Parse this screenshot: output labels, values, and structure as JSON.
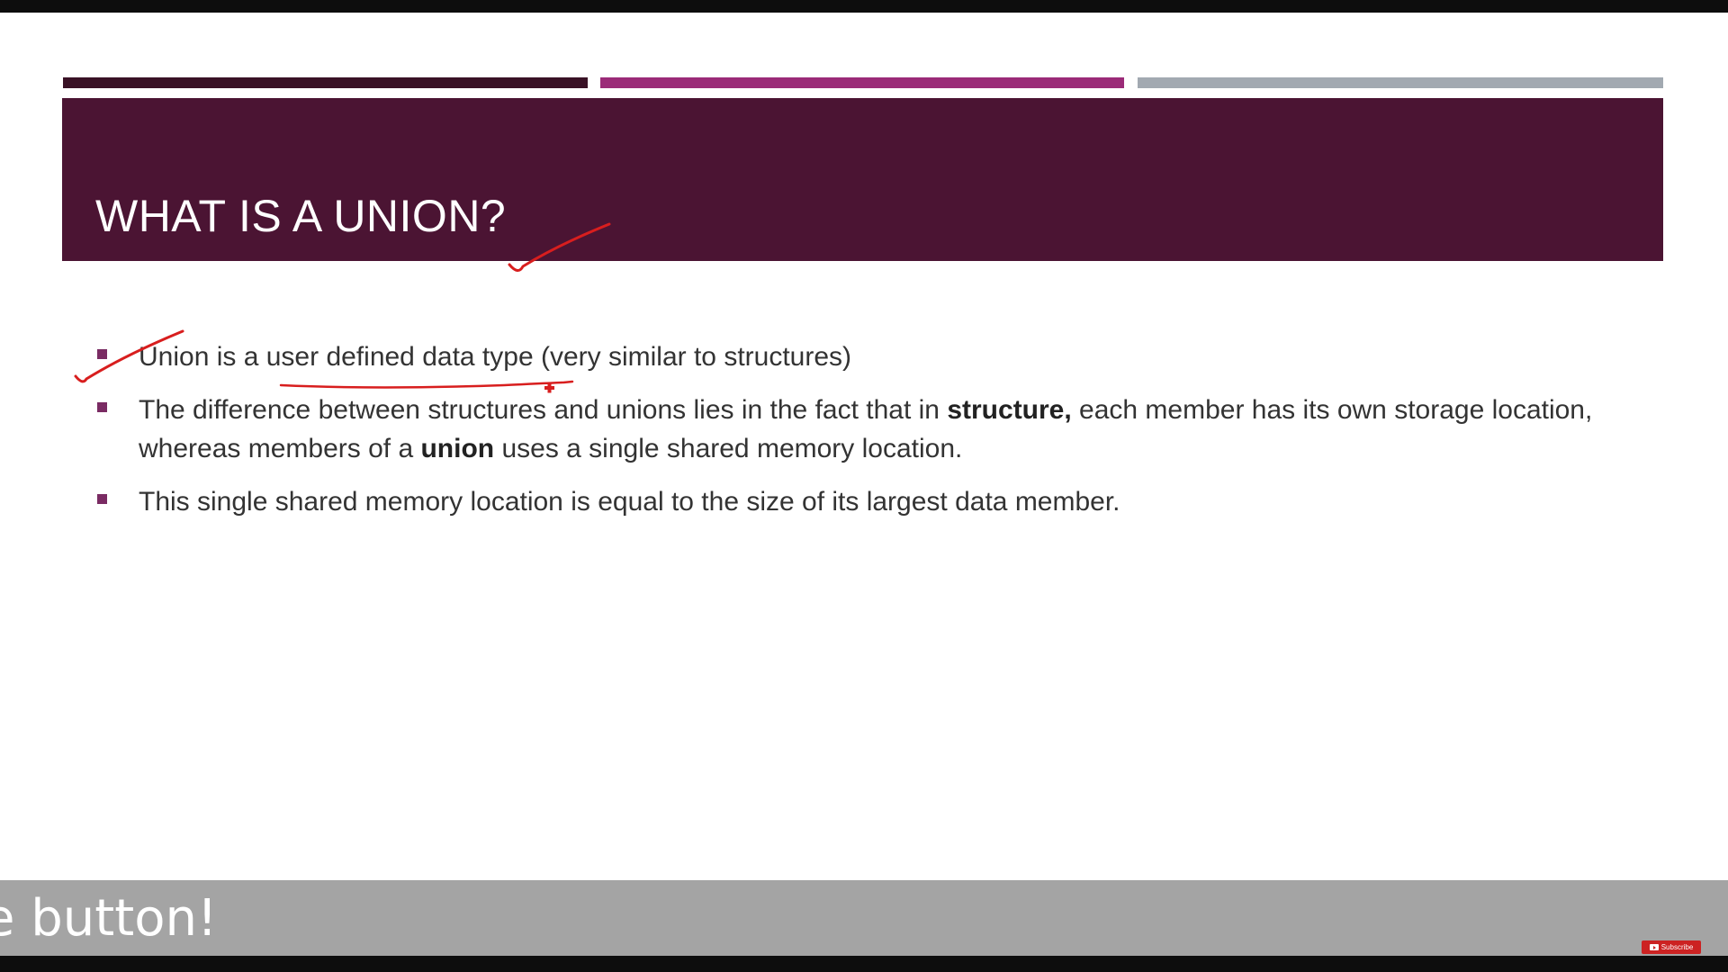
{
  "slide": {
    "title": "WHAT IS A UNION?",
    "bullets": [
      {
        "segments": [
          {
            "text": "Union is a ",
            "bold": false
          },
          {
            "text": "user defined data type",
            "bold": false
          },
          {
            "text": " (very similar to structures)",
            "bold": false
          }
        ]
      },
      {
        "segments": [
          {
            "text": "The difference between structures and unions lies in the fact that in ",
            "bold": false
          },
          {
            "text": "structure,",
            "bold": true
          },
          {
            "text": " each member has its own storage location, whereas members of a ",
            "bold": false
          },
          {
            "text": "union",
            "bold": true
          },
          {
            "text": " uses a single shared memory location.",
            "bold": false
          }
        ]
      },
      {
        "segments": [
          {
            "text": "This single shared memory location is equal to the size of its largest data member.",
            "bold": false
          }
        ]
      }
    ]
  },
  "overlay": {
    "caption": "e button!",
    "subscribe_label": "Subscribe"
  },
  "colors": {
    "title_band": "#4b1433",
    "accent_dark": "#3a1226",
    "accent_magenta": "#9b2b78",
    "accent_gray": "#a2a9b1",
    "bullet_marker": "#7a2b63",
    "annotation_ink": "#d81e1e",
    "caption_bar": "#a4a4a4",
    "subscribe_red": "#cc2222"
  },
  "icons": {
    "bullet": "square-bullet-icon",
    "subscribe": "youtube-play-icon",
    "cursor": "red-cross-cursor-icon"
  }
}
